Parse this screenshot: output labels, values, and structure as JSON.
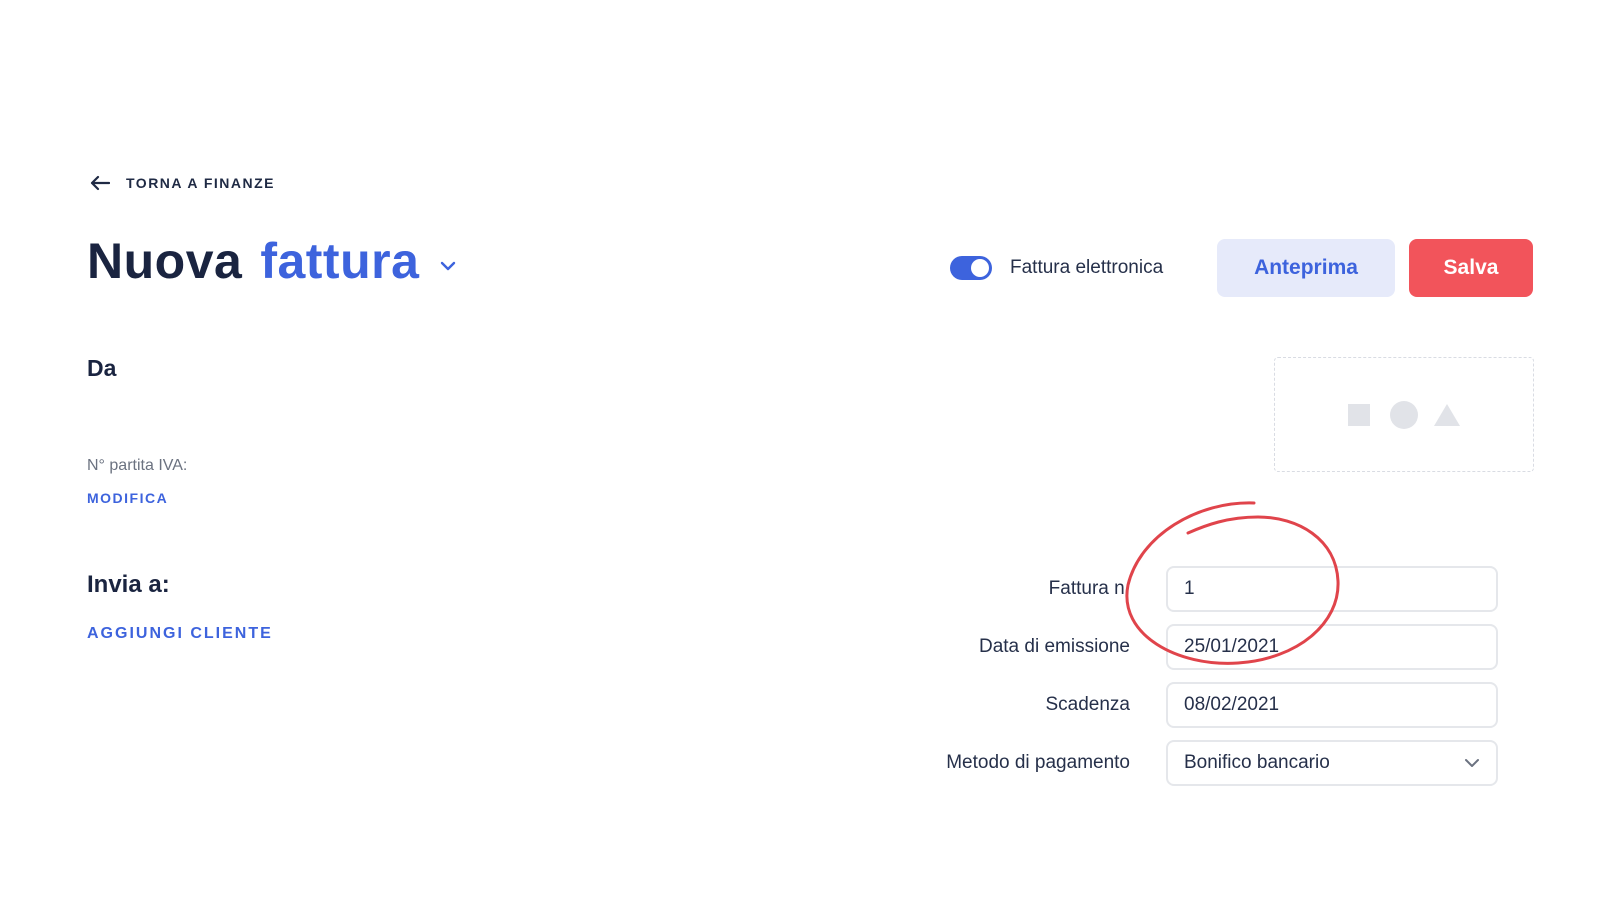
{
  "nav": {
    "back_label": "TORNA A FINANZE"
  },
  "header": {
    "title_main": "Nuova",
    "title_accent": "fattura",
    "e_invoice_label": "Fattura elettronica",
    "e_invoice_enabled": true,
    "preview_label": "Anteprima",
    "save_label": "Salva"
  },
  "sender": {
    "heading": "Da",
    "vat_label": "N° partita IVA:",
    "edit_label": "MODIFICA"
  },
  "recipient": {
    "heading": "Invia a:",
    "add_client_label": "AGGIUNGI CLIENTE"
  },
  "logo_placeholder": {
    "icons": [
      "square-icon",
      "circle-icon",
      "triangle-icon"
    ]
  },
  "invoice_form": {
    "number_label": "Fattura n.",
    "number_value": "1",
    "issue_date_label": "Data di emissione",
    "issue_date_value": "25/01/2021",
    "due_date_label": "Scadenza",
    "due_date_value": "08/02/2021",
    "payment_method_label": "Metodo di pagamento",
    "payment_method_value": "Bonifico bancario"
  },
  "colors": {
    "accent": "#3d63dd",
    "save": "#f2545b",
    "preview_bg": "#e6eafa",
    "annotation": "#e0444b"
  }
}
